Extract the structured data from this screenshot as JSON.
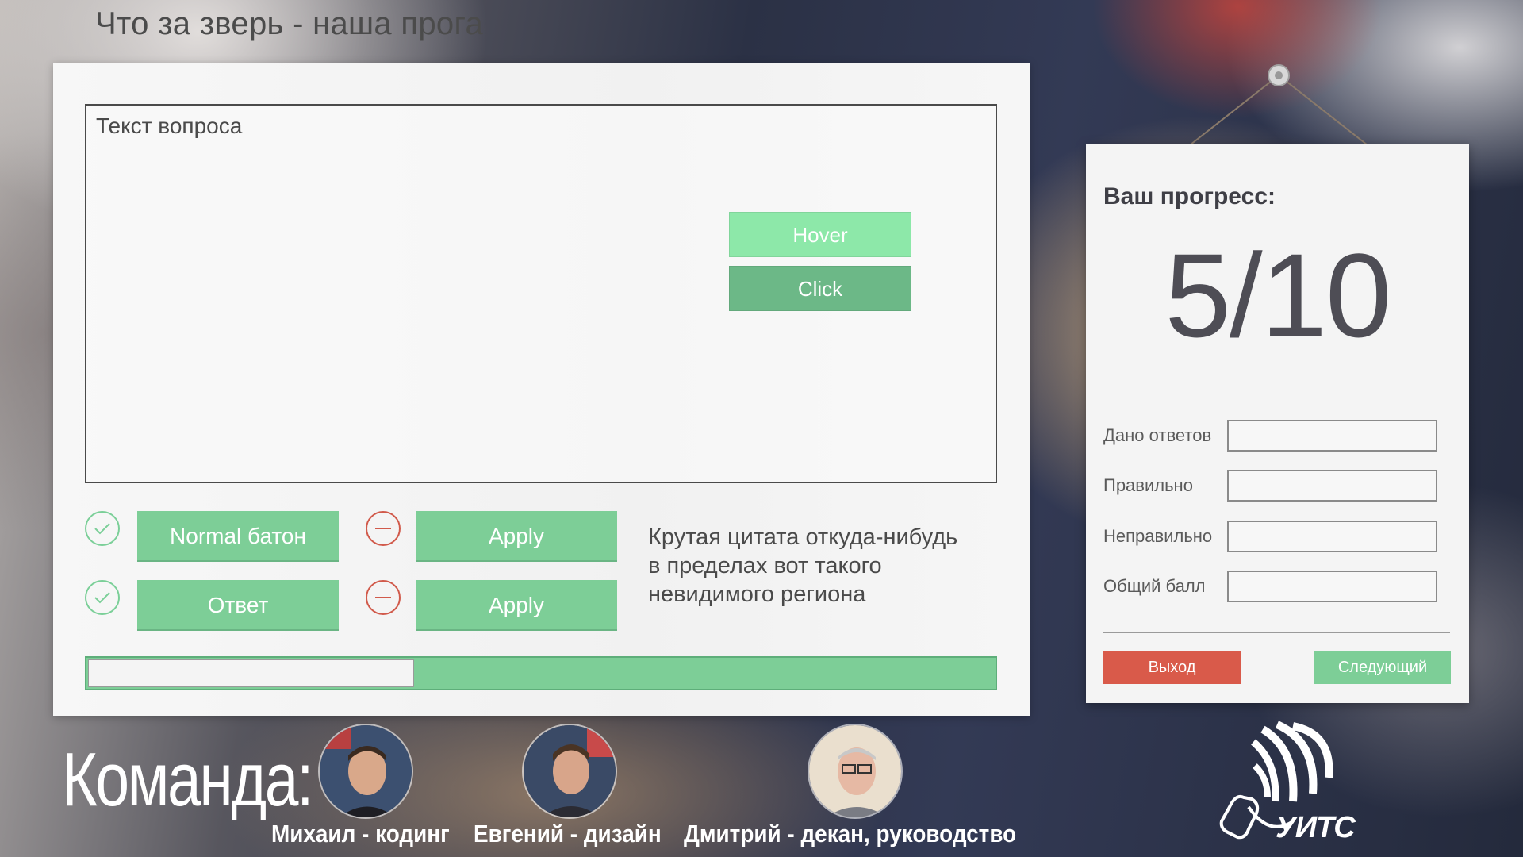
{
  "header": {
    "title": "Что за зверь - наша прога"
  },
  "question": {
    "placeholder_text": "Текст вопроса",
    "hover_button_label": "Hover",
    "click_button_label": "Click"
  },
  "answers": {
    "row1": {
      "answer_label": "Normal батон",
      "apply_label": "Apply"
    },
    "row2": {
      "answer_label": "Ответ",
      "apply_label": "Apply"
    }
  },
  "quote": {
    "lines": [
      "Крутая цитата откуда-нибудь",
      "в пределах вот такого",
      "невидимого региона"
    ]
  },
  "quiz_progress": {
    "filled_fraction": 0.64
  },
  "progress_card": {
    "title": "Ваш прогресс:",
    "score": "5/10",
    "stats": [
      {
        "label": "Дано ответов",
        "value": ""
      },
      {
        "label": "Правильно",
        "value": ""
      },
      {
        "label": "Неправильно",
        "value": ""
      },
      {
        "label": "Общий балл",
        "value": ""
      }
    ],
    "exit_label": "Выход",
    "next_label": "Следующий"
  },
  "team": {
    "title": "Команда:",
    "members": [
      {
        "name": "Михаил - кодинг"
      },
      {
        "name": "Евгений - дизайн"
      },
      {
        "name": "Дмитрий - декан, руководство"
      }
    ],
    "logo_text": "УИТС"
  },
  "colors": {
    "accent_green": "#7dce97",
    "hover_green": "#8de8a9",
    "click_green": "#6cb887",
    "danger_red": "#d95a4a",
    "text_dark": "#4a4a4a"
  },
  "icons": [
    "check-icon",
    "minus-icon",
    "mouse-icon"
  ]
}
